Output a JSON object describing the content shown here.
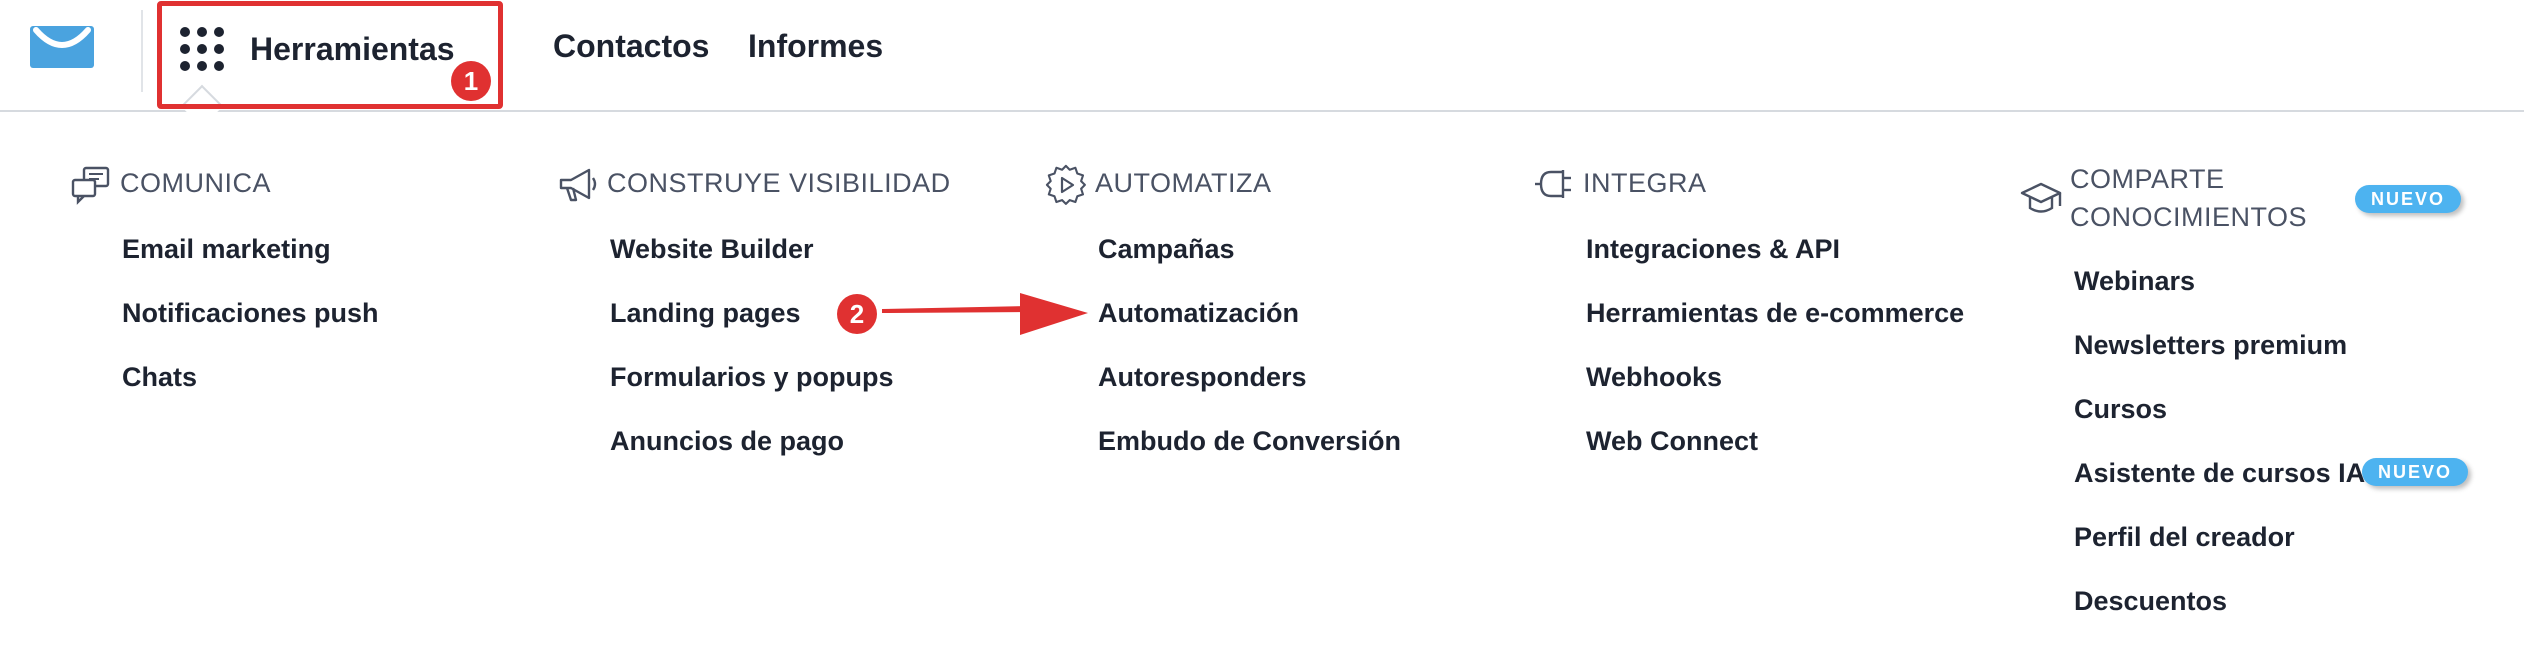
{
  "header": {
    "nav": {
      "tools_label": "Herramientas",
      "contacts_label": "Contactos",
      "reports_label": "Informes"
    }
  },
  "annotations": {
    "step1": "1",
    "step2": "2",
    "highlight_color": "#e03131"
  },
  "menu": {
    "sections": [
      {
        "title": "COMUNICA",
        "icon": "chat-bubbles-icon",
        "items": [
          "Email marketing",
          "Notificaciones push",
          "Chats"
        ]
      },
      {
        "title": "CONSTRUYE VISIBILIDAD",
        "icon": "megaphone-icon",
        "items": [
          "Website Builder",
          "Landing pages",
          "Formularios y popups",
          "Anuncios de pago"
        ]
      },
      {
        "title": "AUTOMATIZA",
        "icon": "gear-play-icon",
        "items": [
          "Campañas",
          "Automatización",
          "Autoresponders",
          "Embudo de Conversión"
        ]
      },
      {
        "title": "INTEGRA",
        "icon": "plug-icon",
        "items": [
          "Integraciones & API",
          "Herramientas de e-commerce",
          "Webhooks",
          "Web Connect"
        ]
      },
      {
        "title_line1": "COMPARTE",
        "title_line2": "CONOCIMIENTOS",
        "icon": "graduation-cap-icon",
        "badge": "NUEVO",
        "items": [
          "Webinars",
          "Newsletters premium",
          "Cursos",
          "Asistente de cursos IA",
          "Perfil del creador",
          "Descuentos"
        ],
        "item_badge": "NUEVO"
      }
    ]
  },
  "colors": {
    "brand_blue": "#4aa3df",
    "badge_blue": "#4db3f0",
    "text_dark": "#1d2330",
    "heading_gray": "#4a5264"
  }
}
